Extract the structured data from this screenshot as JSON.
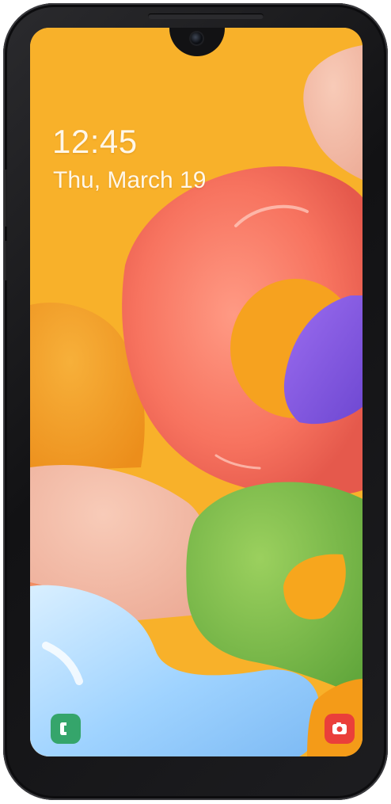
{
  "lock_screen": {
    "time": "12:45",
    "date": "Thu, March 19"
  },
  "shortcuts": [
    {
      "name": "phone",
      "icon": "phone-icon",
      "color": "#35a56b"
    },
    {
      "name": "camera",
      "icon": "camera-icon",
      "color": "#ea3f3a"
    }
  ],
  "colors": {
    "wallpaper_background": "#f8b12a",
    "device_body": "#161618",
    "clock_text": "#fff7e8"
  }
}
